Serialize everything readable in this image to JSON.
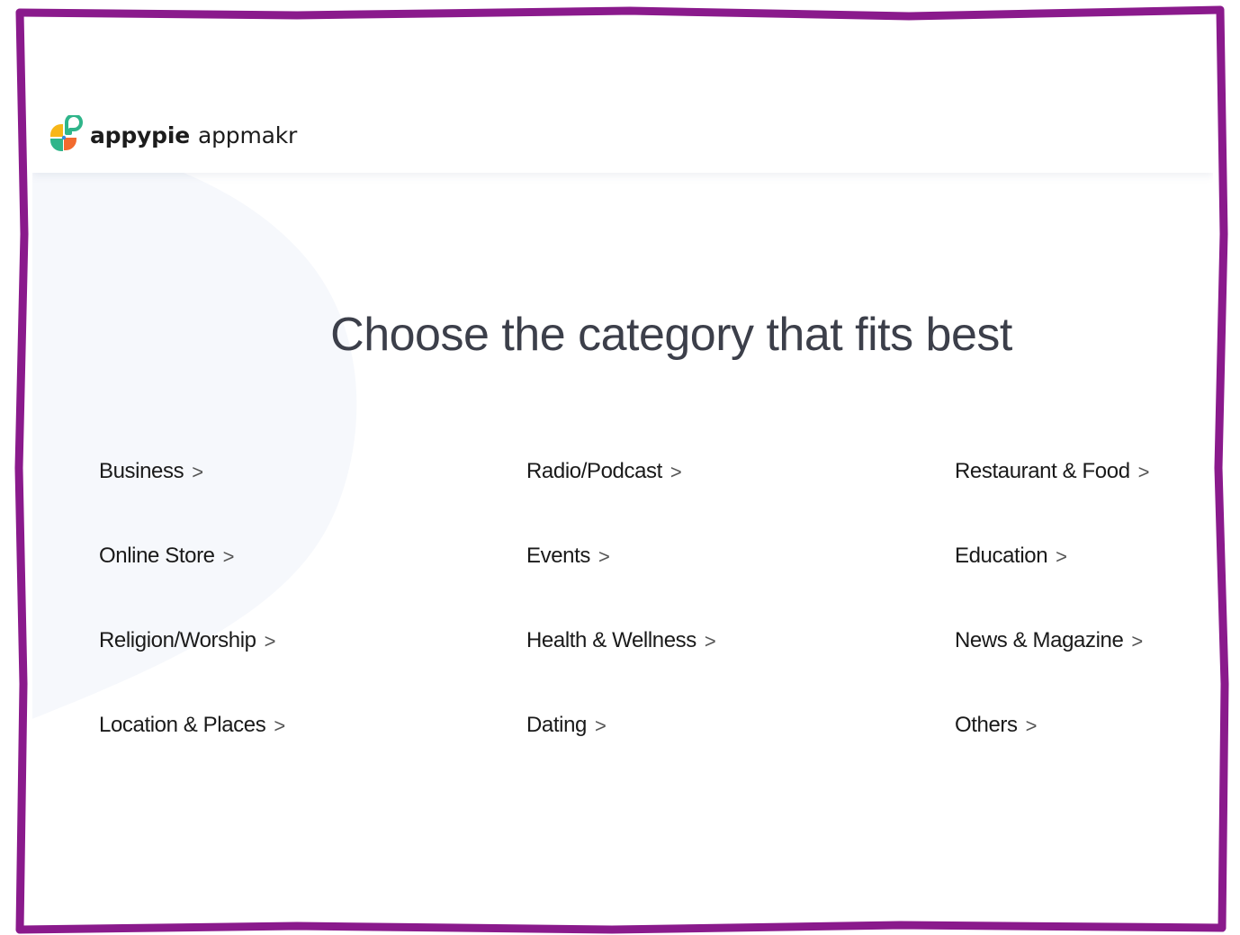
{
  "app": {
    "logo_bold": "appypie",
    "logo_light": "appmakr"
  },
  "page": {
    "title": "Choose the category that fits best"
  },
  "categories": [
    {
      "label": "Business",
      "chevron": ">"
    },
    {
      "label": "Radio/Podcast",
      "chevron": ">"
    },
    {
      "label": "Restaurant & Food",
      "chevron": ">"
    },
    {
      "label": "Online Store",
      "chevron": ">"
    },
    {
      "label": "Events",
      "chevron": ">"
    },
    {
      "label": "Education",
      "chevron": ">"
    },
    {
      "label": "Religion/Worship",
      "chevron": ">"
    },
    {
      "label": "Health & Wellness",
      "chevron": ">"
    },
    {
      "label": "News & Magazine",
      "chevron": ">"
    },
    {
      "label": "Location & Places",
      "chevron": ">"
    },
    {
      "label": "Dating",
      "chevron": ">"
    },
    {
      "label": "Others",
      "chevron": ">"
    }
  ],
  "colors": {
    "frame": "#8a1a8c",
    "title_text": "#3c3f4a",
    "category_text": "#1a1a1a",
    "background_blob": "#f6f8fc",
    "logo_yellow": "#f7b618",
    "logo_orange": "#f26a2e",
    "logo_green": "#2fb58a",
    "logo_blue": "#2f8be6"
  }
}
